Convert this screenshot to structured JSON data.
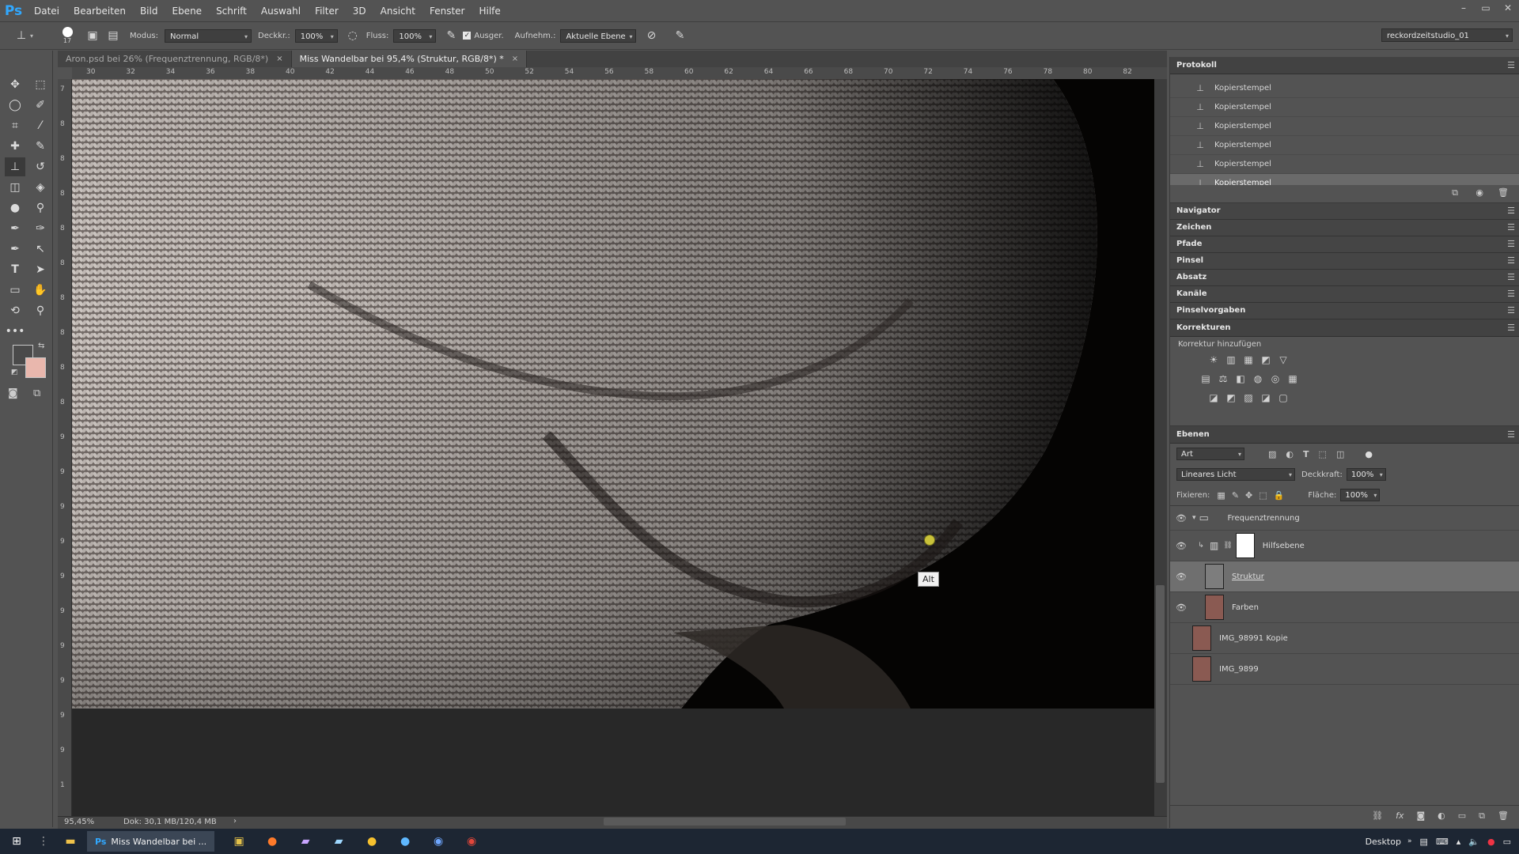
{
  "menu": {
    "logo": "Ps",
    "items": [
      "Datei",
      "Bearbeiten",
      "Bild",
      "Ebene",
      "Schrift",
      "Auswahl",
      "Filter",
      "3D",
      "Ansicht",
      "Fenster",
      "Hilfe"
    ],
    "window_controls": [
      "–",
      "▭",
      "✕"
    ]
  },
  "options": {
    "brush_size": "17",
    "modus_label": "Modus:",
    "modus_value": "Normal",
    "deckkraft_label": "Deckkr.:",
    "deckkraft_value": "100%",
    "fluss_label": "Fluss:",
    "fluss_value": "100%",
    "ausger_label": "Ausger.",
    "aufnehm_label": "Aufnehm.:",
    "aufnehm_value": "Aktuelle Ebene",
    "workspace": "reckordzeitstudio_01"
  },
  "tabs": [
    {
      "label": "Aron.psd bei 26% (Frequenztrennung, RGB/8*)",
      "close": "×",
      "active": false
    },
    {
      "label": "Miss Wandelbar bei 95,4% (Struktur, RGB/8*) *",
      "close": "×",
      "active": true
    }
  ],
  "ruler_h": [
    "30",
    "32",
    "34",
    "36",
    "38",
    "40",
    "42",
    "44",
    "46",
    "48",
    "50",
    "52",
    "54",
    "56",
    "58",
    "60",
    "62",
    "64",
    "66",
    "68",
    "70",
    "72",
    "74",
    "76",
    "78",
    "80",
    "82"
  ],
  "ruler_v": [
    "7",
    "8",
    "8",
    "8",
    "8",
    "8",
    "8",
    "8",
    "8",
    "8",
    "9",
    "9",
    "9",
    "9",
    "9",
    "9",
    "9",
    "9",
    "9",
    "9",
    "1"
  ],
  "canvas": {
    "tooltip": "Alt"
  },
  "status": {
    "zoom": "95,45%",
    "doc": "Dok: 30,1 MB/120,4 MB",
    "arrow": "›"
  },
  "history": {
    "title": "Protokoll",
    "items": [
      "Kopierstempel",
      "Kopierstempel",
      "Kopierstempel",
      "Kopierstempel",
      "Kopierstempel",
      "Kopierstempel"
    ],
    "selected_index": 5
  },
  "collapsed_panels": [
    "Navigator",
    "Zeichen",
    "Pfade",
    "Pinsel",
    "Absatz",
    "Kanäle",
    "Pinselvorgaben"
  ],
  "korrekturen": {
    "title": "Korrekturen",
    "subtitle": "Korrektur hinzufügen",
    "row1": [
      "☀",
      "▥",
      "▦",
      "◩",
      "▽"
    ],
    "row2": [
      "▤",
      "⚖",
      "◧",
      "◍",
      "◎",
      "▦"
    ],
    "row3": [
      "◪",
      "◩",
      "▨",
      "◪",
      "▢"
    ]
  },
  "layers": {
    "title": "Ebenen",
    "filter_label": "Art",
    "blend_mode": "Lineares Licht",
    "deckkraft_label": "Deckkraft:",
    "deckkraft_value": "100%",
    "fixieren_label": "Fixieren:",
    "flaeche_label": "Fläche:",
    "flaeche_value": "100%",
    "group_name": "Frequenztrennung",
    "items": [
      {
        "name": "Hilfsebene",
        "visible": true
      },
      {
        "name": "Struktur",
        "visible": true,
        "selected": true
      },
      {
        "name": "Farben",
        "visible": true
      },
      {
        "name": "IMG_98991 Kopie",
        "visible": false
      },
      {
        "name": "IMG_9899",
        "visible": false
      }
    ]
  },
  "taskbar": {
    "active_app": "Miss Wandelbar bei ...",
    "desktop": "Desktop"
  },
  "colors": {
    "accent_ps": "#31a8ff",
    "background_swatch": "#e9b7ad",
    "foreground_swatch": "#4a4a4a"
  }
}
